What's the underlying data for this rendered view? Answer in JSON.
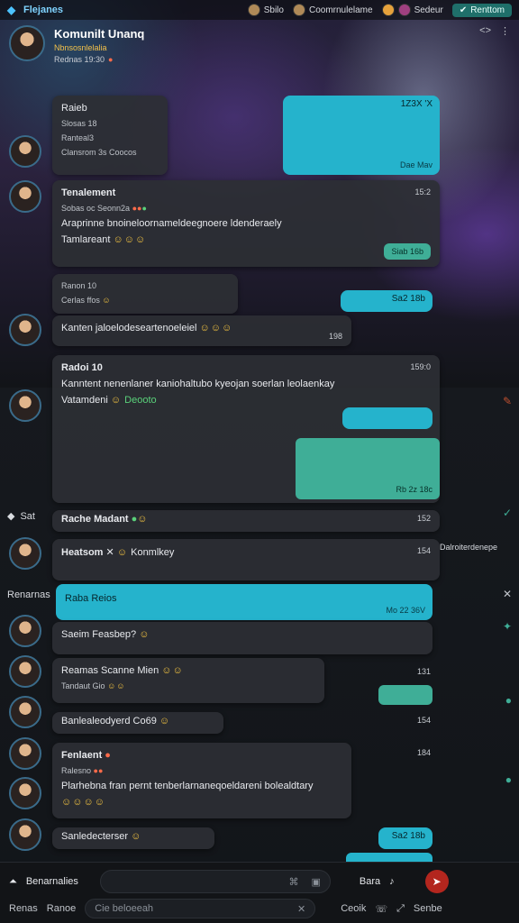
{
  "topbar": {
    "brand": "Flejanes",
    "items": [
      "Sbilo",
      "Coomrnulelame",
      "Sedeur"
    ],
    "button": "Renttom"
  },
  "header": {
    "title": "Komunilt Unanq",
    "subtitle": "Nbnsosnlelalia",
    "status": "Rednas 19:30"
  },
  "messages": [
    {
      "lines": [
        "Raieb",
        "Slosas 18",
        "Ranteal3",
        "Clansrom 3s Coocos"
      ]
    },
    {
      "name": "Tenalement",
      "time": "15:2",
      "line1": "Sobas oc Seonn2a",
      "line2": "Araprinne bnoineloornameldeegnoere ldenderaely",
      "line3": "Tamlareant",
      "pill": "Siab 16b"
    },
    {
      "lines": [
        "Ranon 10",
        "Cerlas ffos"
      ],
      "pill": "Sa2 18b"
    },
    {
      "text": "Kanten jaloelodeseartenoeleiel",
      "time": "198"
    },
    {
      "name": "Radoi 10",
      "time": "159:0",
      "line1": "Kanntent nenenlaner kaniohaltubo kyeojan soerlan leolaenkay",
      "line2": "Vatamdeni",
      "link": "Deooto"
    },
    {
      "name": "Rache Madant",
      "time": "152"
    },
    {
      "name": "Heatsom",
      "extra": "Konmlkey",
      "time": "154"
    },
    {
      "text": "Raba Reios",
      "time": "Mo 22 36V"
    },
    {
      "text": "Saeim Feasbep?"
    },
    {
      "line1": "Reamas Scanne Mien",
      "line2": "Tandaut Gio",
      "time": "131"
    },
    {
      "text": "Banlealeodyerd",
      "extra": "Co69",
      "time": "154"
    },
    {
      "name": "Fenlaent",
      "line1": "Ralesno",
      "line2": "Plarhebna fran pernt tenberlarnaneqoeldareni bolealdtary",
      "time": "184"
    },
    {
      "text": "Sanledecterser",
      "pill": "Sa2 18b"
    }
  ],
  "bubbles": [
    {
      "top": "1Z3X 'X",
      "bottom": "Dae Mav"
    },
    {
      "bottom": "Rb 2z 18c"
    }
  ],
  "sections": {
    "sat": "Sat",
    "renarne": "Renarnas",
    "right_label": "Dalroiterdenepe"
  },
  "bottom": {
    "left_label": "Benarnalies",
    "row2_left": "Renas",
    "row2_left2": "Ranoe",
    "placeholder": "Cie beloeeah",
    "send_label": "Bara",
    "row2_mid": "Ceoik",
    "row2_right": "Senbe"
  }
}
